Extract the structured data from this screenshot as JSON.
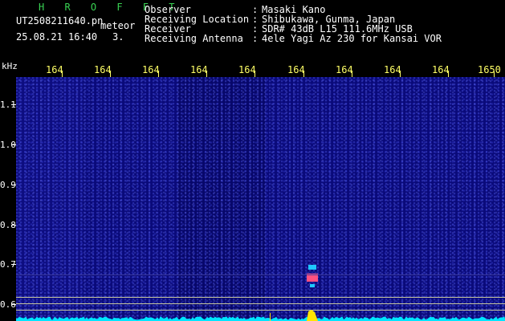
{
  "header": {
    "app_name": "H R O F F T",
    "filename": "UT2508211640.pn",
    "mode": "meteor",
    "datetime": "25.08.21 16:40",
    "count": "3.",
    "fields": [
      {
        "label": "Observer",
        "sep": ":",
        "value": "Masaki Kano"
      },
      {
        "label": "Receiving Location",
        "sep": ":",
        "value": "Shibukawa, Gunma, Japan"
      },
      {
        "label": "Receiver",
        "sep": ":",
        "value": "SDR# 43dB L15 111.6MHz USB"
      },
      {
        "label": "Receiving Antenna",
        "sep": ":",
        "value": "4ele Yagi Az 230 for Kansai VOR"
      }
    ]
  },
  "axis": {
    "unit": "kHz",
    "x_ticks": [
      "164",
      "164",
      "164",
      "164",
      "164",
      "164",
      "164",
      "164",
      "164",
      "1650"
    ],
    "y_ticks": [
      "1.1",
      "1.0",
      "0.9",
      "0.8",
      "0.7",
      "0.6"
    ]
  },
  "colors": {
    "background": "#000000",
    "spectrogram": "#0a0a7a",
    "tick_color": "#ffff66",
    "trace": "#00e5ff",
    "echo": "#ffe400"
  }
}
